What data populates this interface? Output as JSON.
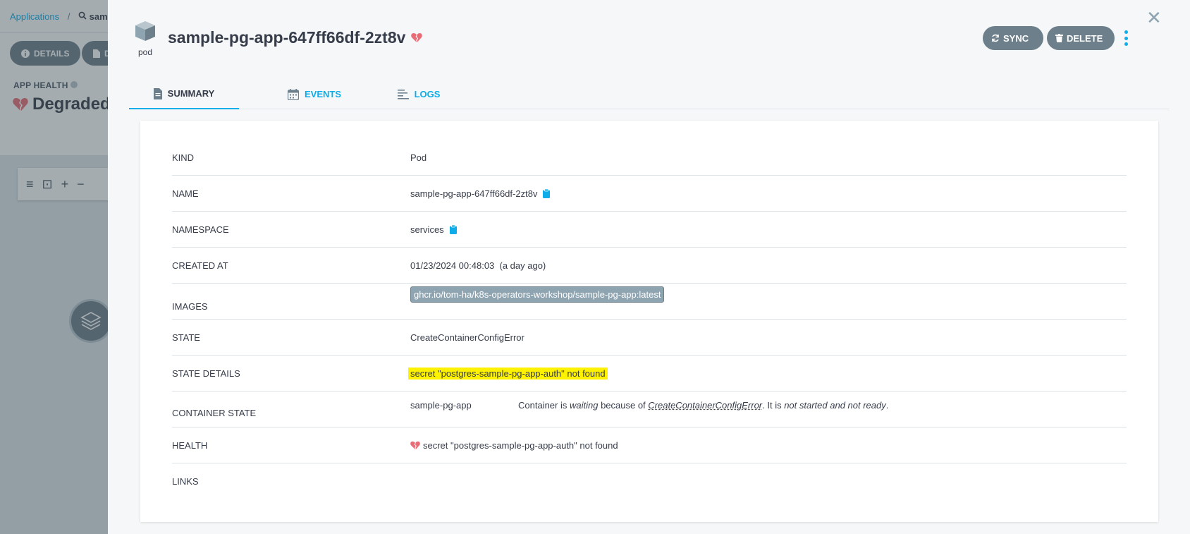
{
  "background": {
    "breadcrumb": {
      "root": "Applications",
      "search": "samp"
    },
    "buttons": {
      "details": "DETAILS",
      "diff": "DI"
    },
    "app_health": {
      "label": "APP HEALTH",
      "value": "Degraded"
    }
  },
  "panel": {
    "kind_label": "pod",
    "title": "sample-pg-app-647ff66df-2zt8v",
    "actions": {
      "sync": "SYNC",
      "delete": "DELETE"
    },
    "tabs": [
      {
        "label": "SUMMARY"
      },
      {
        "label": "EVENTS"
      },
      {
        "label": "LOGS"
      }
    ],
    "summary": {
      "kind": {
        "key": "KIND",
        "value": "Pod"
      },
      "name": {
        "key": "NAME",
        "value": "sample-pg-app-647ff66df-2zt8v"
      },
      "namespace": {
        "key": "NAMESPACE",
        "value": "services"
      },
      "created_at": {
        "key": "CREATED AT",
        "value": "01/23/2024 00:48:03  (a day ago)"
      },
      "images": {
        "key": "IMAGES",
        "value": "ghcr.io/tom-ha/k8s-operators-workshop/sample-pg-app:latest"
      },
      "state": {
        "key": "STATE",
        "value": "CreateContainerConfigError"
      },
      "state_details": {
        "key": "STATE DETAILS",
        "value": "secret \"postgres-sample-pg-app-auth\" not found"
      },
      "container_state": {
        "key": "CONTAINER STATE",
        "container": "sample-pg-app",
        "msg_prefix": "Container is ",
        "msg_waiting": "waiting",
        "msg_because": " because of ",
        "msg_reason": "CreateContainerConfigError",
        "msg_middle": ". It is ",
        "msg_status": "not started and not ready",
        "msg_end": "."
      },
      "health": {
        "key": "HEALTH",
        "value": "secret \"postgres-sample-pg-app-auth\" not found"
      },
      "links": {
        "key": "LINKS",
        "value": ""
      }
    }
  },
  "colors": {
    "accent": "#0dadea",
    "button_gray": "#6d7f8b",
    "degraded": "#e96d76",
    "highlight": "#fff200"
  },
  "icons": [
    "cube-icon",
    "broken-heart-icon",
    "sync-icon",
    "trash-icon",
    "kebab-icon",
    "close-icon",
    "file-icon",
    "calendar-icon",
    "logs-icon",
    "clipboard-icon"
  ]
}
